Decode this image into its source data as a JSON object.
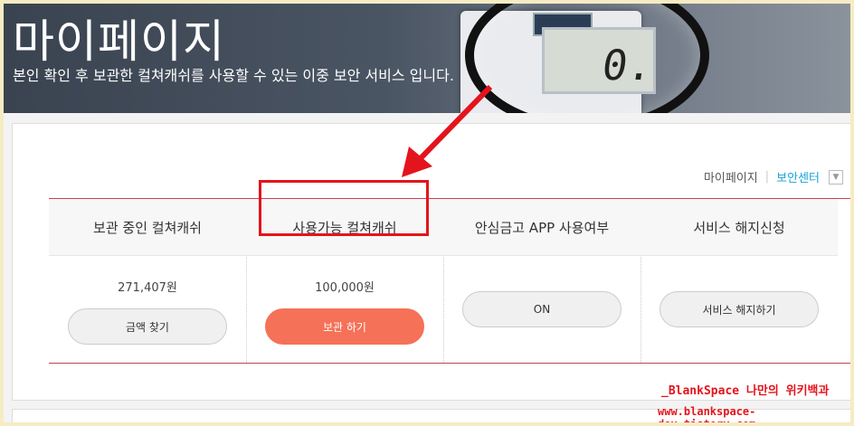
{
  "banner": {
    "title": "마이페이지",
    "subtitle": "본인 확인 후 보관한 컬쳐캐쉬를 사용할 수 있는 이중 보안 서비스 입니다.",
    "calculator_digit": "0."
  },
  "breadcrumb": {
    "home": "마이페이지",
    "current": "보안센터",
    "dropdown_icon": "chevron-down-icon"
  },
  "table": {
    "columns": [
      {
        "header": "보관 중인 컬쳐캐쉬",
        "amount": "271,407원",
        "button": "금액 찾기"
      },
      {
        "header": "사용가능 컬쳐캐쉬",
        "amount": "100,000원",
        "button": "보관 하기"
      },
      {
        "header": "안심금고 APP 사용여부",
        "amount": "",
        "button": "ON"
      },
      {
        "header": "서비스 해지신청",
        "amount": "",
        "button": "서비스 해지하기"
      }
    ]
  },
  "annotation": {
    "arrow_color": "#e4141c",
    "highlight_color": "#e4141c"
  },
  "watermark": {
    "line1": "_BlankSpace 나만의 위키백과",
    "line2": "www.blankspace-dev.tistory.com"
  },
  "colors": {
    "accent": "#1aa3d9",
    "primary_button": "#f57157",
    "table_border": "#c4405a"
  }
}
